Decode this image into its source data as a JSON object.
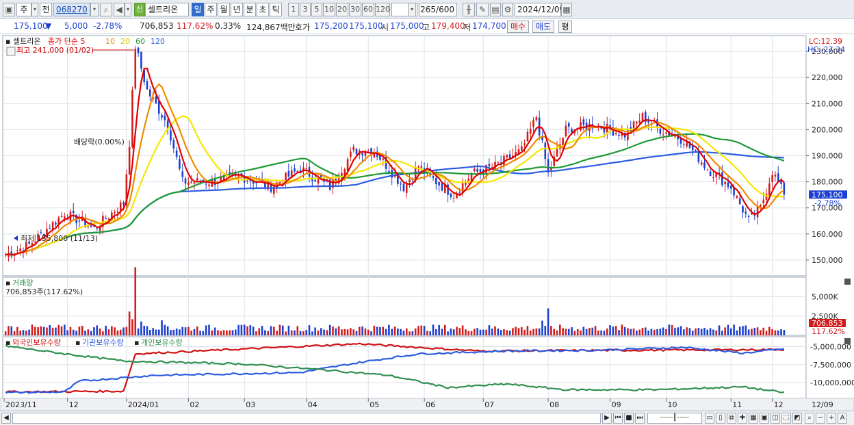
{
  "toolbar": {
    "market_type": "주",
    "prev_label": "전",
    "stock_code": "068270",
    "new_badge": "신",
    "stock_name": "셀트리온",
    "periods": [
      "일",
      "주",
      "월",
      "년",
      "분",
      "초",
      "틱"
    ],
    "selected_period": "일",
    "numbers": [
      "1",
      "3",
      "5",
      "10",
      "20",
      "30",
      "60",
      "120"
    ],
    "count_value": "265",
    "count_max": "/600",
    "date": "2024/12/09"
  },
  "quote": {
    "price": "175,100",
    "change_arrow": "▼",
    "change": "5,000",
    "change_rate": "-2.78%",
    "volume": "706,853",
    "volume_ratio": "117.62%",
    "turnover": "0.33%",
    "amount": "124,867백만",
    "ask_label": "호가",
    "ask": "175,200",
    "bid": "175,100",
    "open_label": "시",
    "open": "175,000",
    "high_label": "고",
    "high": "179,400",
    "low_label": "저",
    "low": "174,700",
    "buy_label": "매수",
    "sell_label": "매도",
    "eval_label": "평"
  },
  "price_panel": {
    "legend_name": "셀트리온",
    "legend_ma_label": "종가 단순 5",
    "legend_ma": [
      "10",
      "20",
      "60",
      "120"
    ],
    "max_label": "최고 241,000 (01/02)",
    "min_label": "최저 155,800 (11/13)",
    "event_label": "배당락(0.00%)",
    "lc_label": "LC:12.39",
    "hc_label": "HC:-27.34",
    "current_price_tag": "175,100",
    "current_rate_tag": "-2.78%",
    "y_ticks": [
      "230,000",
      "220,000",
      "210,000",
      "200,000",
      "190,000",
      "180,000",
      "170,000",
      "160,000",
      "150,000"
    ]
  },
  "volume_panel": {
    "title": "거래량",
    "value_label": "706,853주(117.62%)",
    "y_ticks": [
      "5,000K",
      "2,500K"
    ],
    "current_tag": "706,853",
    "current_ratio_tag": "117.62%"
  },
  "holdings_panel": {
    "legend": [
      "외국인보유수량",
      "기관보유수량",
      "개인보유수량"
    ],
    "y_ticks": [
      "-5,000,000",
      "-7,500,000",
      "-10,000,000"
    ]
  },
  "x_axis": {
    "labels": [
      "2023/11",
      "12",
      "2024/01",
      "02",
      "03",
      "04",
      "05",
      "06",
      "07",
      "08",
      "09",
      "10",
      "11",
      "12"
    ],
    "right_label": "12/09"
  },
  "colors": {
    "up": "#d21b1b",
    "down": "#1b3fd0",
    "ma5": "#e00000",
    "ma10": "#f08a00",
    "ma20": "#f5e600",
    "ma60": "#1e9a34",
    "ma120": "#2c5ce0",
    "foreign": "#d01010",
    "institution": "#2c5ce0",
    "individual": "#2f8f4f"
  },
  "chart_data": {
    "type": "line",
    "title": "셀트리온",
    "x_range": [
      "2023/11",
      "2024/12/09"
    ],
    "ylim": [
      145000,
      235000
    ],
    "price_key_points": [
      {
        "date": "2023/11",
        "close": 152000
      },
      {
        "date": "2023/11/13",
        "close": 155800
      },
      {
        "date": "2023/12",
        "close": 165000
      },
      {
        "date": "2024/01/02",
        "close": 241000
      },
      {
        "date": "2024/01",
        "close": 210000
      },
      {
        "date": "2024/02",
        "close": 180000
      },
      {
        "date": "2024/03",
        "close": 180000
      },
      {
        "date": "2024/04",
        "close": 185000
      },
      {
        "date": "2024/05",
        "close": 192000
      },
      {
        "date": "2024/06",
        "close": 185000
      },
      {
        "date": "2024/07",
        "close": 178000
      },
      {
        "date": "2024/08",
        "close": 205000
      },
      {
        "date": "2024/09",
        "close": 200000
      },
      {
        "date": "2024/10",
        "close": 195000
      },
      {
        "date": "2024/11",
        "close": 165000
      },
      {
        "date": "2024/12/09",
        "close": 175100
      }
    ],
    "volume_ylim": [
      0,
      7000
    ],
    "holdings_ylim": [
      -12000000,
      -4000000
    ]
  }
}
